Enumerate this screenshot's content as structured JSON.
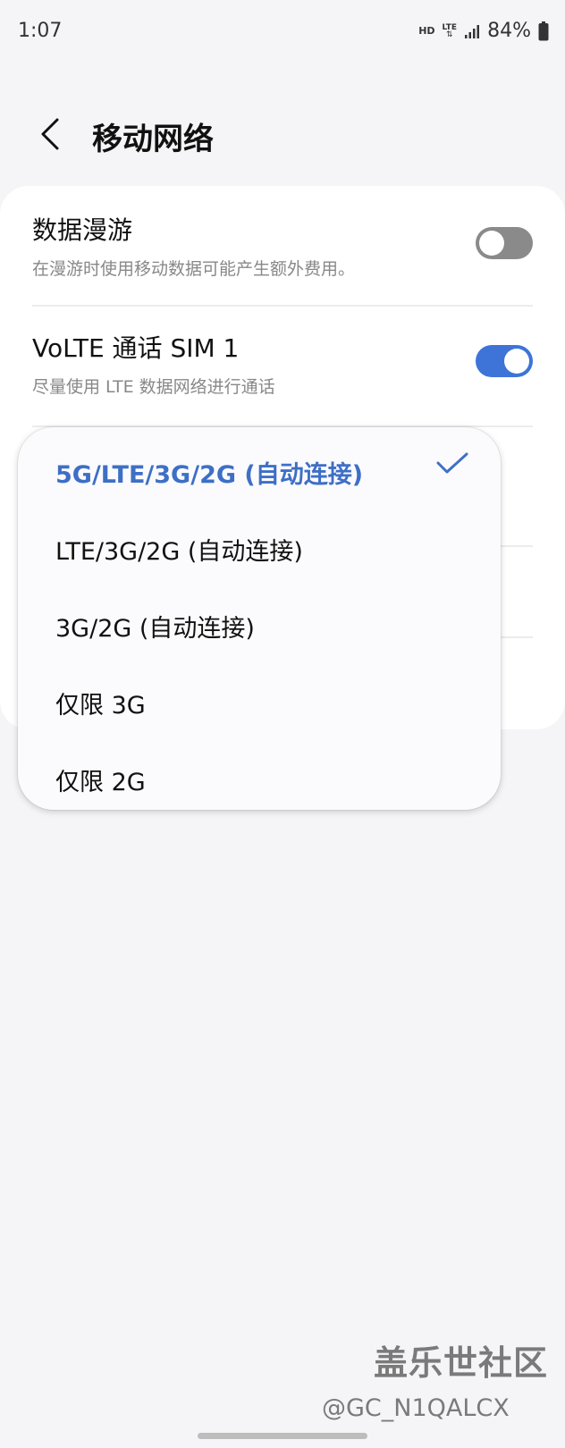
{
  "status_bar": {
    "time": "1:07",
    "hd": "HD",
    "network": "LTE",
    "battery": "84%"
  },
  "header": {
    "title": "移动网络"
  },
  "settings": {
    "data_roaming": {
      "title": "数据漫游",
      "summary": "在漫游时使用移动数据可能产生额外费用。",
      "enabled": false
    },
    "volte": {
      "title": "VoLTE 通话 SIM 1",
      "summary": "尽量使用 LTE 数据网络进行通话",
      "enabled": true
    }
  },
  "network_mode_menu": {
    "options": [
      {
        "label": "5G/LTE/3G/2G (自动连接)",
        "selected": true
      },
      {
        "label": "LTE/3G/2G (自动连接)",
        "selected": false
      },
      {
        "label": "3G/2G (自动连接)",
        "selected": false
      },
      {
        "label": "仅限 3G",
        "selected": false
      },
      {
        "label": "仅限 2G",
        "selected": false
      }
    ]
  },
  "watermark": {
    "title": "盖乐世社区",
    "handle": "@GC_N1QALCX"
  },
  "colors": {
    "accent": "#3e74d8",
    "selected_text": "#3e6fc6",
    "background": "#f5f5f7",
    "card": "#ffffff"
  }
}
